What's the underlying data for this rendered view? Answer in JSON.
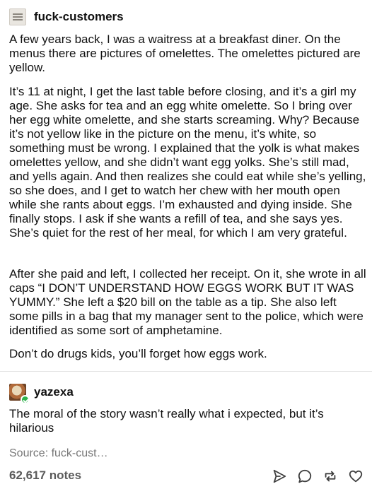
{
  "original_post": {
    "username": "fuck-customers",
    "paragraphs": [
      "A few years back, I was a waitress at a breakfast diner. On the menus there are pictures of omelettes. The omelettes pictured are yellow.",
      "It’s 11 at night, I get the last table before closing, and it’s a girl my age. She asks for tea and an egg white omelette. So I bring over her egg white omelette, and she starts screaming. Why? Because it’s not yellow like in the picture on the menu, it’s white, so something must be wrong. I explained that the yolk is what makes omelettes yellow, and she didn’t want egg yolks. She’s still mad, and yells again. And then realizes she could eat while she’s yelling, so she does, and I get to watch her chew with her mouth open while she rants about eggs. I’m exhausted and dying inside. She finally stops. I ask if she wants a refill of tea, and she says yes. She’s quiet for the rest of her meal, for which I am very grateful.",
      "After she paid and left, I collected her receipt. On it, she wrote in all caps “I DON’T UNDERSTAND HOW EGGS WORK BUT IT WAS YUMMY.” She left a $20 bill on the table as a tip. She also left some pills in a bag that my manager sent to the police, which were identified as some sort of amphetamine.",
      "Don’t do drugs kids, you’ll forget how eggs work."
    ]
  },
  "reblog": {
    "username": "yazexa",
    "text": "The moral of the story wasn’t really what i expected, but it’s hilarious"
  },
  "footer": {
    "source": "Source: fuck-cust…",
    "notes": "62,617 notes",
    "actions": [
      {
        "name": "share",
        "icon": "send-icon"
      },
      {
        "name": "reply",
        "icon": "reply-bubble-icon"
      },
      {
        "name": "reblog",
        "icon": "reblog-icon"
      },
      {
        "name": "like",
        "icon": "heart-icon"
      }
    ]
  },
  "colors": {
    "text": "#111111",
    "muted": "#777777",
    "notes": "#5b5b5b",
    "divider": "#e2e2e2",
    "badge": "#2fb44d"
  }
}
